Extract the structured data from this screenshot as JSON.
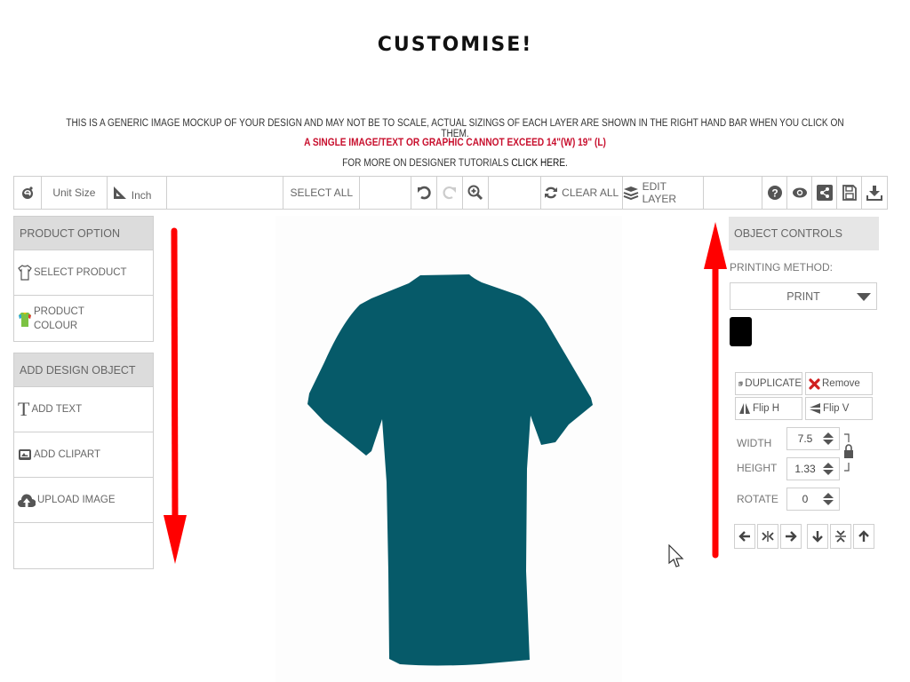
{
  "page": {
    "title": "CUSTOMISE!",
    "notice_line1": "THIS IS A GENERIC IMAGE MOCKUP OF YOUR DESIGN AND MAY NOT BE TO SCALE, ACTUAL SIZINGS OF EACH LAYER ARE SHOWN IN THE RIGHT HAND BAR WHEN YOU CLICK ON THEM.",
    "notice_line2": "A SINGLE IMAGE/TEXT OR GRAPHIC CANNOT EXCEED 14\"(W) 19\" (L)",
    "notice_line3_prefix": "FOR MORE ON DESIGNER TUTORIALS ",
    "notice_line3_link": "CLICK HERE",
    "notice_line3_suffix": ".",
    "warning_color": "#c8102e"
  },
  "toolbar": {
    "logo_icon": "designer-logo-icon",
    "unit_size_label": "Unit Size",
    "unit_value": "Inch",
    "select_all_label": "SELECT ALL",
    "undo_icon": "undo-icon",
    "redo_icon": "redo-icon",
    "zoom_icon": "zoom-in-icon",
    "clear_all_label": "CLEAR ALL",
    "edit_layer_label": "EDIT LAYER",
    "help_icon": "help-icon",
    "preview_icon": "eye-icon",
    "share_icon": "share-icon",
    "save_icon": "save-icon",
    "download_icon": "download-icon"
  },
  "left_panel": {
    "product_option": {
      "header": "PRODUCT OPTION",
      "items": [
        {
          "label": "SELECT PRODUCT",
          "icon": "tshirt-outline-icon"
        },
        {
          "label_line1": "PRODUCT",
          "label_line2": "COLOUR",
          "icon": "colour-shirt-icon"
        }
      ]
    },
    "add_design_object": {
      "header": "ADD DESIGN OBJECT",
      "items": [
        {
          "label": "ADD TEXT",
          "icon": "text-icon"
        },
        {
          "label": "ADD CLIPART",
          "icon": "clipart-icon"
        },
        {
          "label": "UPLOAD IMAGE",
          "icon": "upload-cloud-icon"
        }
      ]
    }
  },
  "canvas": {
    "product": "t-shirt",
    "product_colour": "#065a69"
  },
  "annotations": {
    "arrow_color": "#ff0000",
    "left_arrow_direction": "down",
    "right_arrow_direction": "up"
  },
  "right_panel": {
    "header": "OBJECT CONTROLS",
    "printing_method_label": "PRINTING METHOD:",
    "printing_method_value": "PRINT",
    "selected_colour": "#000000",
    "duplicate_label": "DUPLICATE",
    "remove_label": "Remove",
    "flip_h_label": "Flip H",
    "flip_v_label": "Flip V",
    "width_label": "WIDTH",
    "width_value": "7.5",
    "height_label": "HEIGHT",
    "height_value": "1.33",
    "rotate_label": "ROTATE",
    "rotate_value": "0",
    "aspect_lock": "locked",
    "align_buttons": [
      "align-left",
      "center-horizontal",
      "align-right",
      "align-bottom",
      "center-vertical",
      "align-top"
    ]
  }
}
